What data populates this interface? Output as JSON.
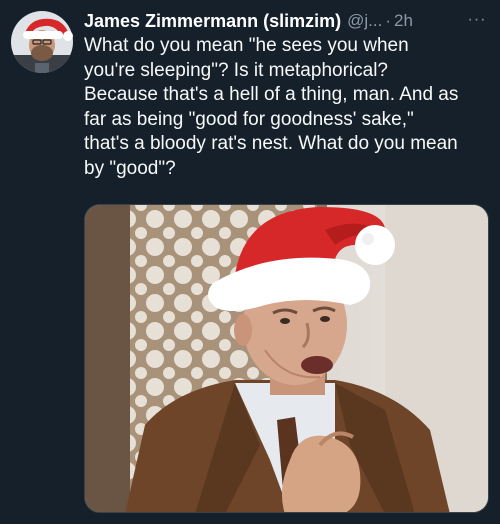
{
  "tweet": {
    "author_name": "James Zimmermann (slimzim)",
    "handle": "@j...",
    "separator": "·",
    "time": "2h",
    "more_label": "···",
    "body_lines": [
      "What do you mean \"he sees you when",
      "you're sleeping\"? Is it metaphorical?",
      "Because that's a hell of a thing, man. And as",
      "far as being \"good for goodness' sake,\"",
      "that's a bloody rat's nest. What do you mean",
      "by \"good\"?"
    ]
  },
  "colors": {
    "background": "#15202b",
    "primary_text": "#f7f9f9",
    "secondary_text": "#8b98a5",
    "santa_hat_red": "#d62828"
  },
  "icons": {
    "more": "more-horizontal-icon",
    "avatar_hat": "santa-hat-icon"
  }
}
